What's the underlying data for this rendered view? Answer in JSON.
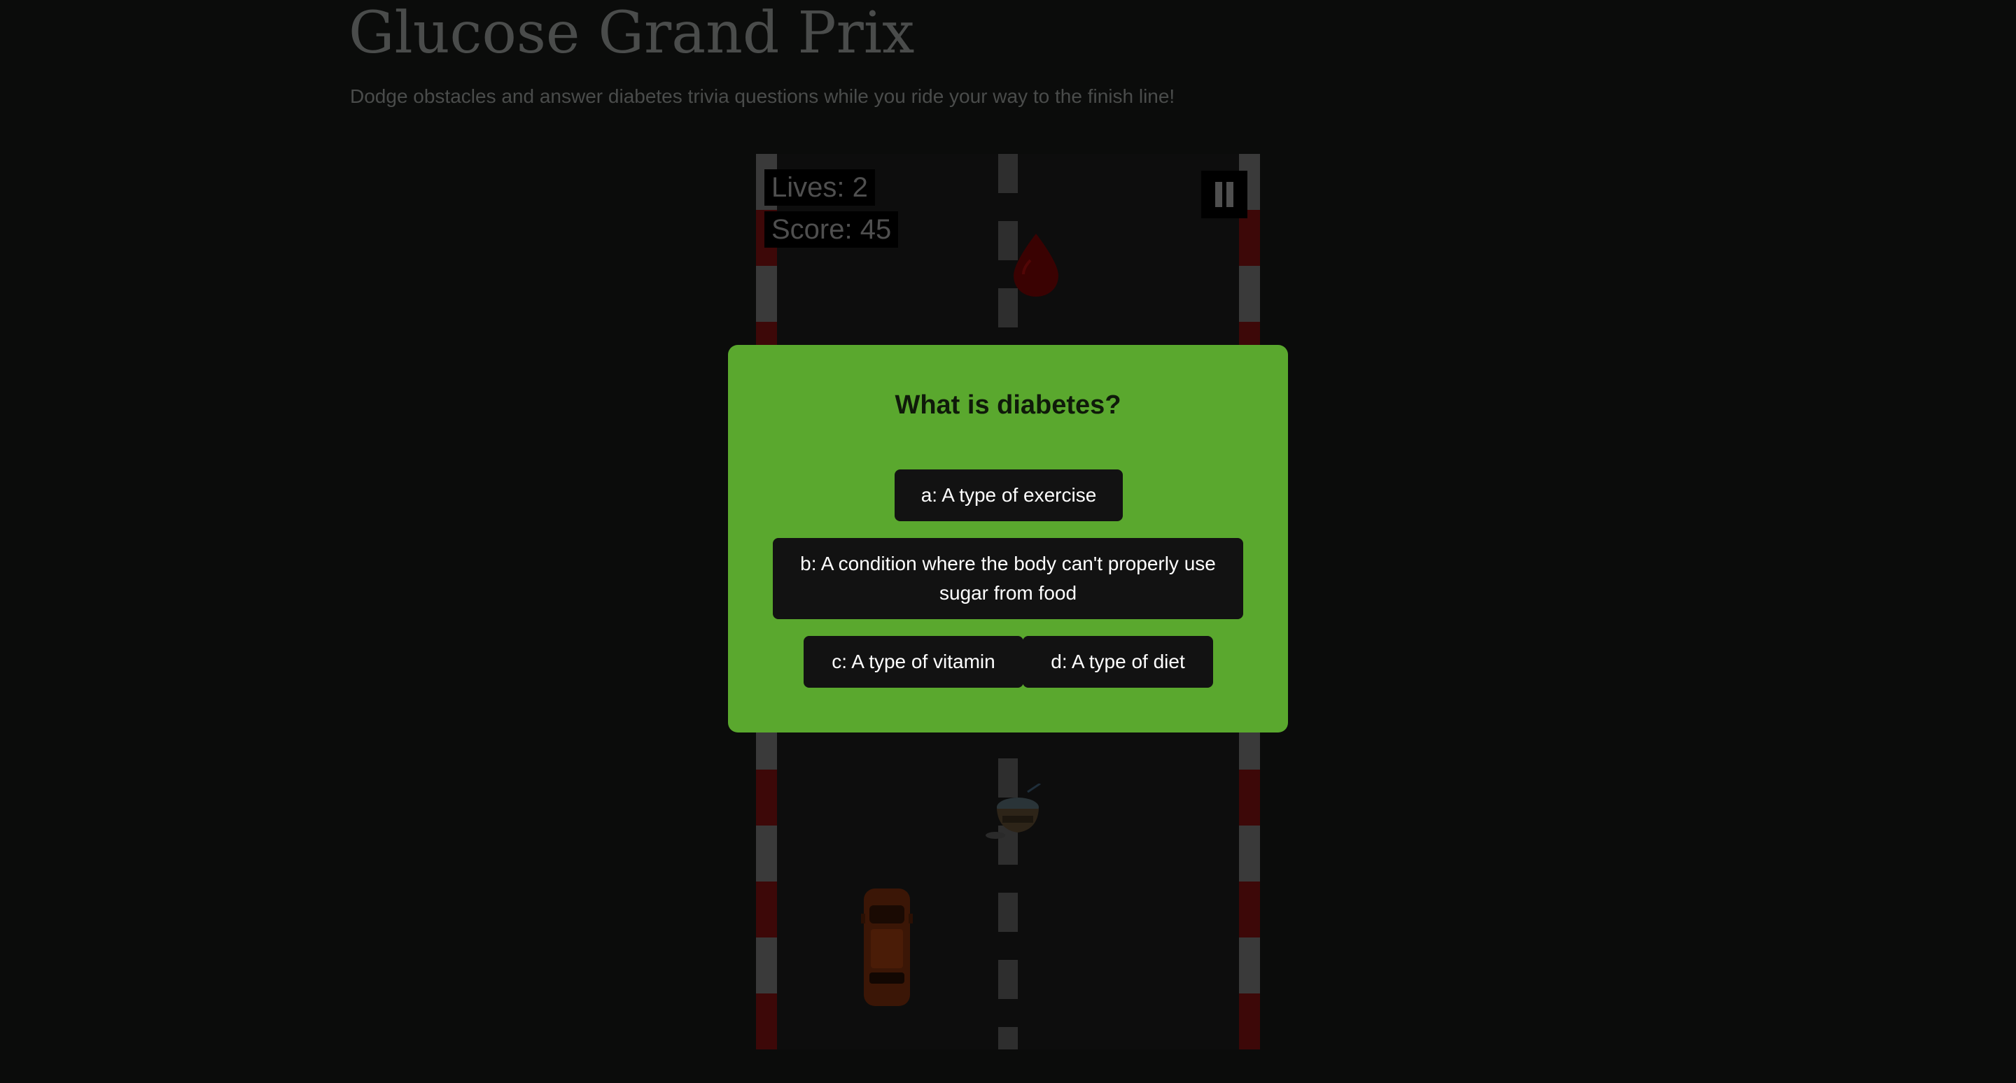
{
  "page": {
    "title": "Glucose Grand Prix",
    "subtitle": "Dodge obstacles and answer diabetes trivia questions while you ride your way to the finish line!"
  },
  "hud": {
    "lives_text": "Lives: 2",
    "score_text": "Score: 45",
    "lives": 2,
    "score": 45,
    "pause_icon": "pause-icon"
  },
  "sprites": {
    "drop": "blood-drop-icon",
    "obstacle": "food-bowl-icon",
    "player": "car-icon"
  },
  "trivia": {
    "question": "What is diabetes?",
    "answers": [
      {
        "label": "a: A type of exercise"
      },
      {
        "label": "b: A condition where the body can't properly use sugar from food"
      },
      {
        "label": "c: A type of vitamin"
      },
      {
        "label": "d: A type of diet"
      }
    ]
  },
  "colors": {
    "background": "#0b0c0b",
    "modal": "#5aa82e",
    "button": "#121212",
    "curb_red": "#3d0808",
    "curb_grey": "#3a3a3a"
  }
}
